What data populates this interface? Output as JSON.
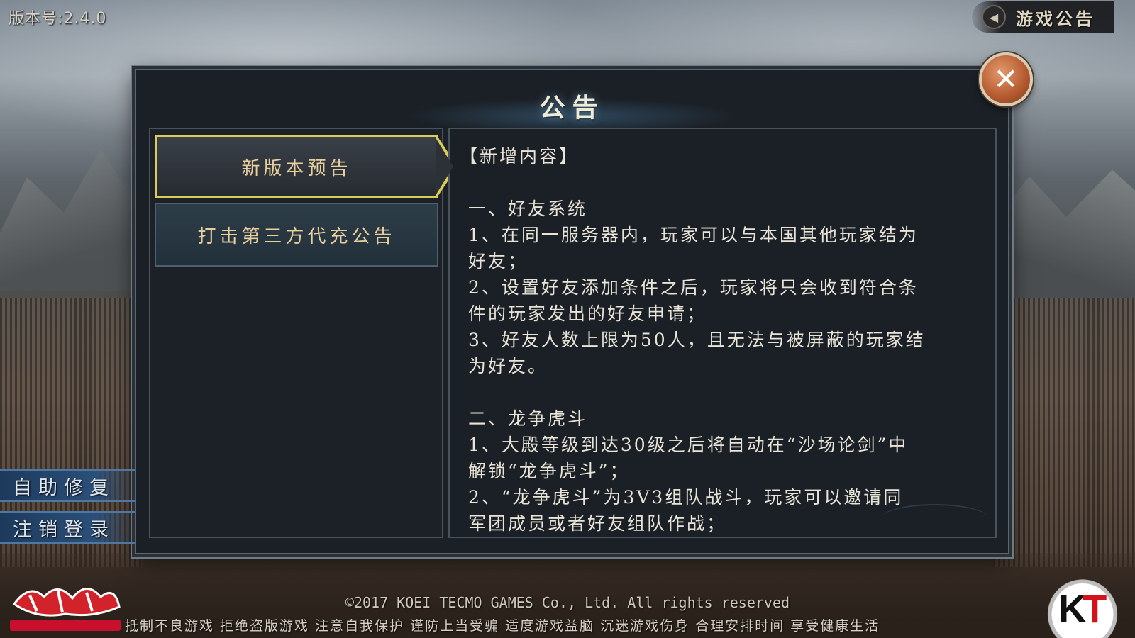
{
  "version_label": "版本号:2.4.0",
  "game_notice_button": {
    "label": "游戏公告",
    "icon": "speaker-icon"
  },
  "dialog": {
    "title": "公告",
    "close_icon": "close-icon",
    "tabs": [
      {
        "label": "新版本预告",
        "active": true
      },
      {
        "label": "打击第三方代充公告",
        "active": false
      }
    ],
    "content": {
      "section_title": "【新增内容】",
      "sections": [
        {
          "heading": "一、好友系统",
          "lines": [
            "1、在同一服务器内，玩家可以与本国其他玩家结为",
            "好友；",
            "2、设置好友添加条件之后，玩家将只会收到符合条",
            "件的玩家发出的好友申请；",
            "3、好友人数上限为50人，且无法与被屏蔽的玩家结",
            "为好友。"
          ]
        },
        {
          "heading": "二、龙争虎斗",
          "lines": [
            "1、大殿等级到达30级之后将自动在“沙场论剑”中",
            "解锁“龙争虎斗”；",
            "2、“龙争虎斗”为3V3组队战斗，玩家可以邀请同",
            "军团成员或者好友组队作战；"
          ]
        }
      ]
    }
  },
  "side_buttons": {
    "repair": "自助修复",
    "logout": "注销登录"
  },
  "footer": {
    "copyright": "©2017  KOEI TECMO GAMES Co., Ltd. All rights reserved",
    "health_notice": "抵制不良游戏 拒绝盗版游戏 注意自我保护 谨防上当受骗 适度游戏益脑 沉迷游戏伤身 合理安排时间 享受健康生活"
  },
  "logos": {
    "game_logo": "game-title-logo",
    "publisher_logo_k": "K",
    "publisher_logo_t": "T"
  },
  "colors": {
    "tab_active_border": "#d9cc5a",
    "tab_text": "#e8cf9e",
    "close_button": "#b85d33",
    "side_button": "#2b4f78"
  }
}
